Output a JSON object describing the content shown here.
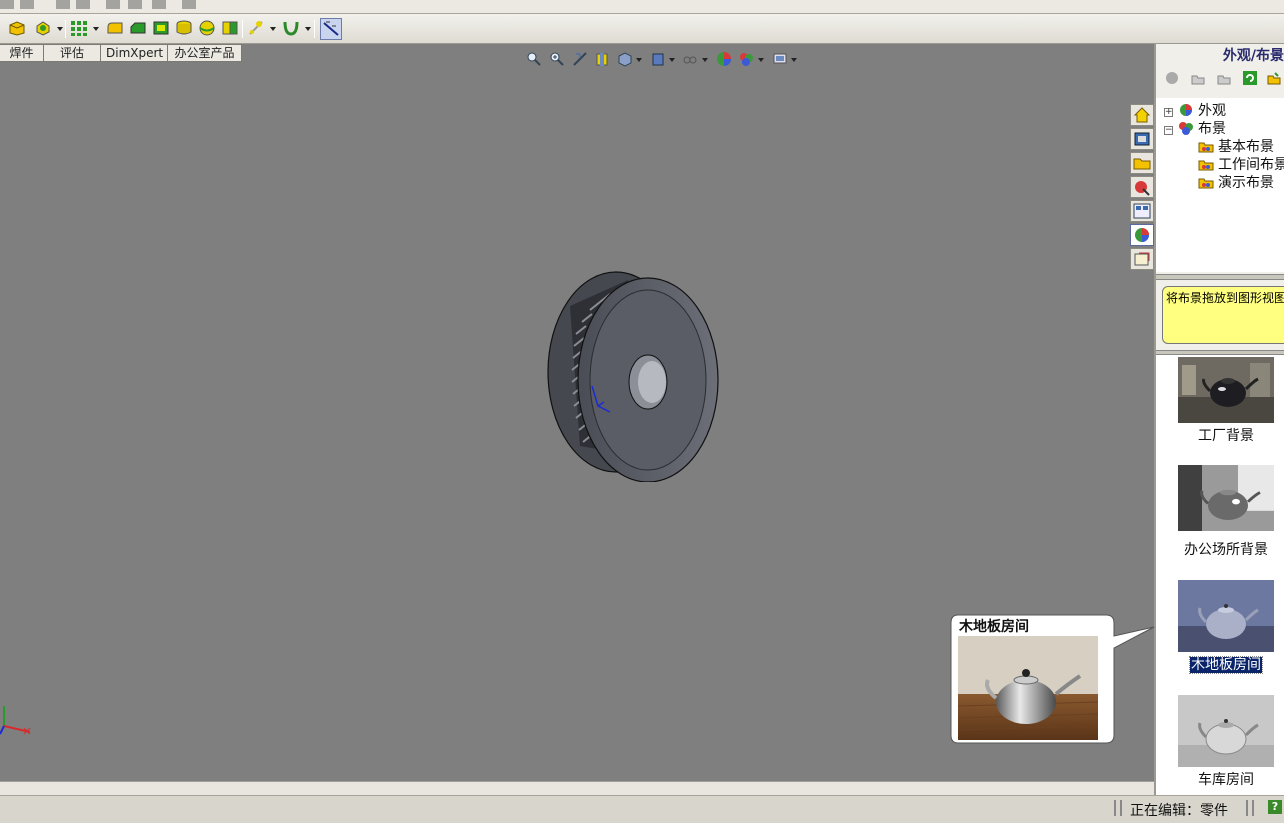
{
  "tabs": [
    "焊件",
    "评估",
    "DimXpert",
    "办公室产品"
  ],
  "taskpane": {
    "title": "外观/布景",
    "tree": {
      "appearances": "外观",
      "scenes": "布景",
      "scene_children": [
        "基本布景",
        "工作间布景",
        "演示布景"
      ]
    },
    "hint": "将布景拖放到图形视图",
    "gallery": [
      {
        "label": "工厂背景"
      },
      {
        "label": "办公场所背景"
      },
      {
        "label": "木地板房间",
        "selected": true
      },
      {
        "label": "车库房间"
      }
    ]
  },
  "preview": {
    "title": "木地板房间"
  },
  "status": {
    "editing": "正在编辑：零件",
    "help": "?"
  },
  "icons": {
    "toolbar": [
      "extrude-icon",
      "revolve-icon",
      "pattern-icon",
      "fillet-icon",
      "chamfer-icon",
      "shell-icon",
      "draft-icon",
      "rib-icon",
      "sketch-icon",
      "curve-icon",
      "measure-icon"
    ],
    "view": [
      "zoom-to-fit-icon",
      "zoom-area-icon",
      "previous-view-icon",
      "section-view-icon",
      "view-orientation-icon",
      "display-style-icon",
      "hide-show-icon",
      "edit-appearance-icon",
      "apply-scene-icon",
      "view-settings-icon"
    ],
    "side": [
      "home-icon",
      "design-library-icon",
      "file-explorer-icon",
      "search-icon",
      "view-palette-icon",
      "appearances-scenes-icon",
      "custom-properties-icon"
    ]
  },
  "colors": {
    "viewport": "#7f7f7f",
    "hint": "#ffff80",
    "selection": "#0a246a"
  }
}
